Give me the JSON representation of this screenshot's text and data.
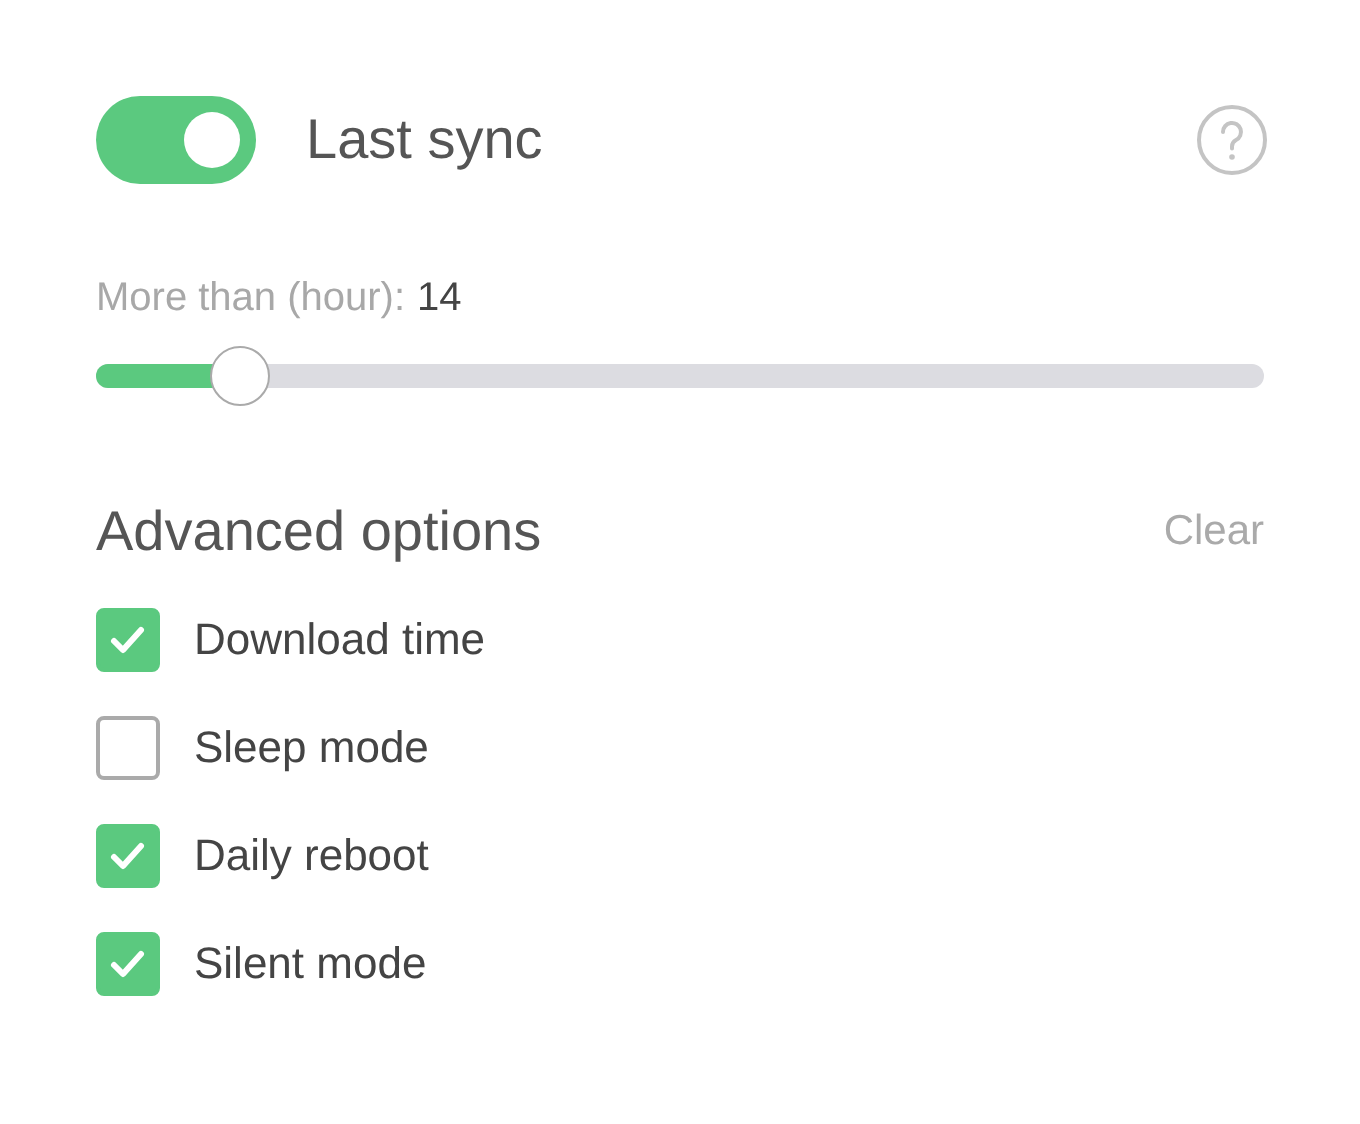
{
  "sync": {
    "on": true,
    "label": "Last sync"
  },
  "slider": {
    "label": "More than (hour):",
    "value": "14",
    "level": 0.123
  },
  "advanced": {
    "title": "Advanced options",
    "clear": "Clear",
    "options": [
      {
        "label": "Download time",
        "checked": true
      },
      {
        "label": "Sleep mode",
        "checked": false
      },
      {
        "label": "Daily reboot",
        "checked": true
      },
      {
        "label": "Silent mode",
        "checked": true
      }
    ]
  }
}
